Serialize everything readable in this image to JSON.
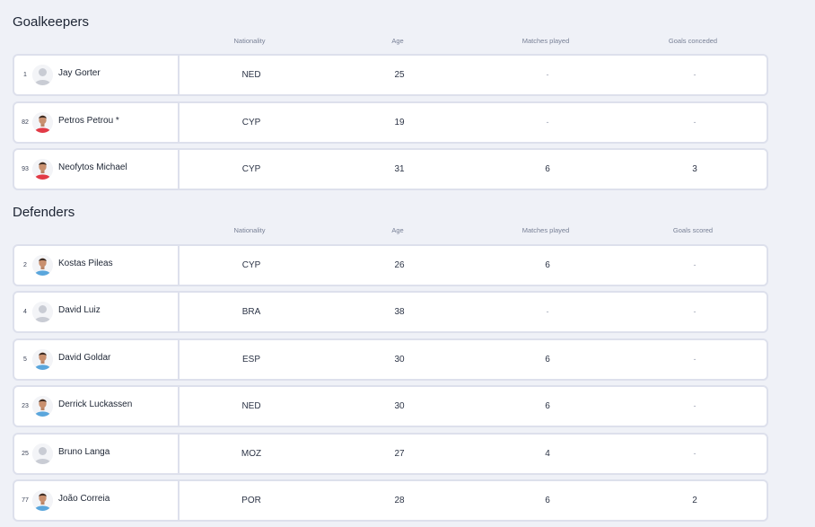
{
  "sections": [
    {
      "title": "Goalkeepers",
      "headers": {
        "nationality": "Nationality",
        "age": "Age",
        "matches": "Matches played",
        "goals": "Goals conceded"
      },
      "players": [
        {
          "number": "1",
          "name": "Jay Gorter",
          "nationality": "NED",
          "age": "25",
          "matches": "-",
          "goals": "-",
          "avatar": "placeholder-avatar-icon"
        },
        {
          "number": "82",
          "name": "Petros Petrou *",
          "nationality": "CYP",
          "age": "19",
          "matches": "-",
          "goals": "-",
          "avatar": "player-photo-red-kit"
        },
        {
          "number": "93",
          "name": "Neofytos Michael",
          "nationality": "CYP",
          "age": "31",
          "matches": "6",
          "goals": "3",
          "avatar": "player-photo-red-kit"
        }
      ]
    },
    {
      "title": "Defenders",
      "headers": {
        "nationality": "Nationality",
        "age": "Age",
        "matches": "Matches played",
        "goals": "Goals scored"
      },
      "players": [
        {
          "number": "2",
          "name": "Kostas Pileas",
          "nationality": "CYP",
          "age": "26",
          "matches": "6",
          "goals": "-",
          "avatar": "player-photo-blue-kit"
        },
        {
          "number": "4",
          "name": "David Luiz",
          "nationality": "BRA",
          "age": "38",
          "matches": "-",
          "goals": "-",
          "avatar": "placeholder-avatar-icon"
        },
        {
          "number": "5",
          "name": "David Goldar",
          "nationality": "ESP",
          "age": "30",
          "matches": "6",
          "goals": "-",
          "avatar": "player-photo-blue-kit"
        },
        {
          "number": "23",
          "name": "Derrick Luckassen",
          "nationality": "NED",
          "age": "30",
          "matches": "6",
          "goals": "-",
          "avatar": "player-photo-blue-kit"
        },
        {
          "number": "25",
          "name": "Bruno Langa",
          "nationality": "MOZ",
          "age": "27",
          "matches": "4",
          "goals": "-",
          "avatar": "placeholder-avatar-icon"
        },
        {
          "number": "77",
          "name": "João Correia",
          "nationality": "POR",
          "age": "28",
          "matches": "6",
          "goals": "2",
          "avatar": "player-photo-blue-kit"
        }
      ]
    }
  ],
  "colors": {
    "background": "#eff1f7",
    "card": "#ffffff",
    "card_border": "#dde0ec",
    "red_kit": "#e23a46",
    "blue_kit": "#5aa6dc",
    "placeholder": "#c9ccd4"
  }
}
